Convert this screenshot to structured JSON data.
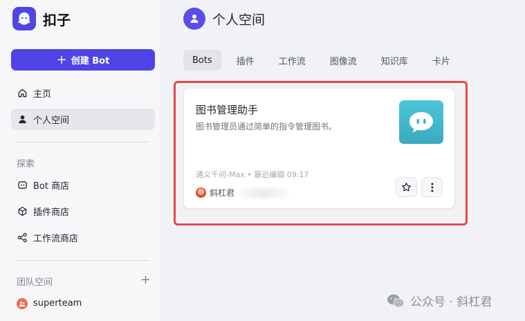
{
  "app": {
    "name": "扣子"
  },
  "sidebar": {
    "create_button": "创建 Bot",
    "nav": [
      {
        "label": "主页"
      },
      {
        "label": "个人空间"
      }
    ],
    "explore_label": "探索",
    "explore": [
      {
        "label": "Bot 商店"
      },
      {
        "label": "插件商店"
      },
      {
        "label": "工作流商店"
      }
    ],
    "team_label": "团队空间",
    "teams": [
      {
        "label": "superteam"
      }
    ]
  },
  "main": {
    "title": "个人空间",
    "tabs": [
      "Bots",
      "插件",
      "工作流",
      "图像流",
      "知识库",
      "卡片"
    ],
    "active_tab": "Bots",
    "card": {
      "name": "图书管理助手",
      "description": "图书管理员通过简单的指令管理图书。",
      "meta": "通义千问-Max • 最近编辑 09:17",
      "author": "斜杠君"
    }
  },
  "watermark": {
    "text": "公众号 · 斜杠君"
  },
  "colors": {
    "accent": "#4d45e5",
    "highlight": "#e5484d",
    "bot_avatar": "#3fb5ca"
  }
}
